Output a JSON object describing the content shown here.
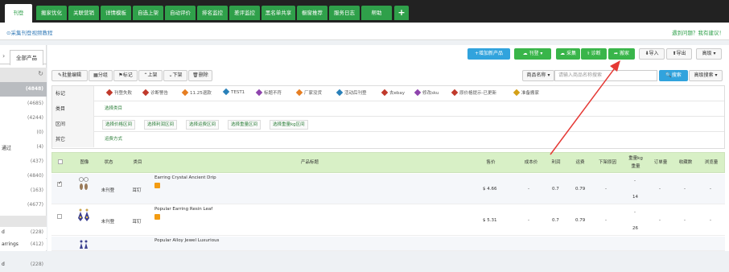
{
  "topnav": {
    "tabs": [
      "刊登",
      "搬家优化",
      "关联营销",
      "详情模板",
      "自选上架",
      "自动评价",
      "排名监控",
      "差评监控",
      "黑名单共享",
      "橱窗推荐",
      "服务日志",
      "帮助",
      "+"
    ]
  },
  "subbar": {
    "link": "⊙采集刊登视频教程",
    "help": "遇到问题？我有建议！"
  },
  "sidebar": {
    "tab_label": "全部产品",
    "rows": [
      {
        "label": "",
        "count": ""
      },
      {
        "label": "",
        "count": "(4848)"
      },
      {
        "label": "",
        "count": "(4685)"
      },
      {
        "label": "",
        "count": "(4244)"
      },
      {
        "label": "",
        "count": "(0)"
      },
      {
        "label": "通过",
        "count": "(4)"
      },
      {
        "label": "",
        "count": "(437)"
      },
      {
        "label": "",
        "count": "(4840)"
      },
      {
        "label": "",
        "count": "(163)"
      },
      {
        "label": "",
        "count": "(4677)"
      },
      {
        "label": "",
        "count": ""
      },
      {
        "label": "",
        "count": ""
      },
      {
        "label": "d",
        "count": "(228)"
      },
      {
        "label": "arrings",
        "count": "(412)"
      }
    ]
  },
  "toolbar": {
    "add_product": "+增加新产品",
    "publish": "刊登",
    "collect": "采集",
    "diagnose": "诊断",
    "move": "搬家",
    "import": "导入",
    "export": "导出",
    "advanced": "高级"
  },
  "toolbar2": {
    "batch_edit": "批量编辑",
    "group": "分组",
    "mark": "标记",
    "up": "上架",
    "down": "下架",
    "delete": "删除",
    "product_name_select": "商品名称",
    "search_placeholder": "请输入商品名称搜索",
    "search": "搜索",
    "advanced_search": "高级搜索"
  },
  "filter": {
    "tag_label": "标记",
    "tags": [
      {
        "text": "刊登失败",
        "color": "#c0392b"
      },
      {
        "text": "诊断警告",
        "color": "#c0392b"
      },
      {
        "text": "11.25退款",
        "color": "#e67e22"
      },
      {
        "text": "TEST1",
        "color": "#2980b9"
      },
      {
        "text": "标题不符",
        "color": "#8e44ad"
      },
      {
        "text": "厂家没货",
        "color": "#e67e22"
      },
      {
        "text": "活动后刊登",
        "color": "#2980b9"
      },
      {
        "text": "去ebay",
        "color": "#c0392b"
      },
      {
        "text": "修改sku",
        "color": "#8e44ad"
      },
      {
        "text": "原价格提示-已更新",
        "color": "#c0392b"
      },
      {
        "text": "准备搬家",
        "color": "#d4a017"
      }
    ],
    "category_label": "类目",
    "category_chip": "选择类目",
    "range_label": "区间",
    "range_chips": [
      "选择价格区间",
      "选择利润区间",
      "选择运费区间",
      "选择重量区间",
      "选择重量kg区间"
    ],
    "other_label": "其它",
    "other_chip": "运费方式"
  },
  "table": {
    "headers": [
      "图像",
      "状态",
      "类目",
      "产品标题",
      "售价",
      "成本价",
      "利润",
      "运费",
      "下架原因",
      "重量kg",
      "重量",
      "订单量",
      "收藏数",
      "浏览量"
    ],
    "rows": [
      {
        "checked": true,
        "status": "未刊登",
        "category": "耳钉",
        "title": "Earring Crystal Ancient Drip",
        "price": "$ 4.66",
        "cost": "-",
        "profit": "0.7",
        "shipping": "0.79",
        "reason": "-",
        "weight_kg": "-",
        "weight": "14",
        "orders": "-",
        "favorites": "-",
        "views": "-"
      },
      {
        "checked": false,
        "status": "未刊登",
        "category": "耳钉",
        "title": "Popular Earring Resin Leaf",
        "price": "$ 5.31",
        "cost": "-",
        "profit": "0.7",
        "shipping": "0.79",
        "reason": "-",
        "weight_kg": "-",
        "weight": "26",
        "orders": "-",
        "favorites": "-",
        "views": "-"
      },
      {
        "checked": false,
        "status": "",
        "category": "",
        "title": "Popular Alloy Jewel Luxurious",
        "price": "",
        "cost": "",
        "profit": "",
        "shipping": "",
        "reason": "",
        "weight_kg": "",
        "weight": "",
        "orders": "",
        "favorites": "",
        "views": ""
      }
    ]
  }
}
